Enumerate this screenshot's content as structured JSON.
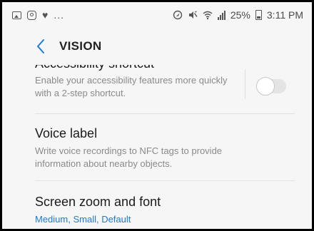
{
  "status_bar": {
    "left_icons": [
      "picture-icon",
      "instagram-icon",
      "heart-icon"
    ],
    "overflow_dots": "...",
    "right_icons": [
      "location-icon",
      "mute-icon",
      "wifi-icon",
      "signal-icon"
    ],
    "battery_percent": "25%",
    "time": "3:11 PM"
  },
  "header": {
    "title": "VISION",
    "back_icon": "chevron-left-icon"
  },
  "settings": [
    {
      "title": "Accessibility shortcut",
      "description": "Enable your accessibility features more quickly with a 2-step shortcut.",
      "toggle": false
    },
    {
      "title": "Voice label",
      "description": "Write voice recordings to NFC tags to provide information about nearby objects."
    },
    {
      "title": "Screen zoom and font",
      "subtitle": "Medium, Small, Default"
    }
  ],
  "colors": {
    "accent": "#1d7bd6",
    "background": "#f6f6f6",
    "title_text": "#1b1b1b",
    "secondary_text": "#8a8a8a"
  }
}
